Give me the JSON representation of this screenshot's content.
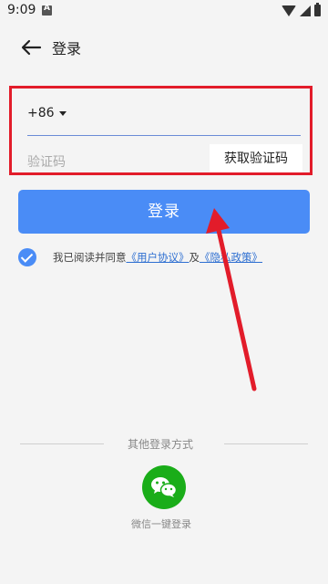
{
  "status_bar": {
    "time": "9:09"
  },
  "header": {
    "title": "登录"
  },
  "form": {
    "country_code": "+86",
    "code_placeholder": "验证码",
    "get_code_label": "获取验证码",
    "login_label": "登录"
  },
  "agreement": {
    "prefix": "我已阅读并同意",
    "user_agreement": "《用户协议》",
    "and": "及",
    "privacy_policy": "《隐私政策》",
    "checked": true
  },
  "other_login": {
    "title": "其他登录方式",
    "wechat_label": "微信一键登录"
  },
  "colors": {
    "accent": "#4a8cf6",
    "annotation_red": "#e21c2a",
    "wechat_green": "#1aad19"
  }
}
